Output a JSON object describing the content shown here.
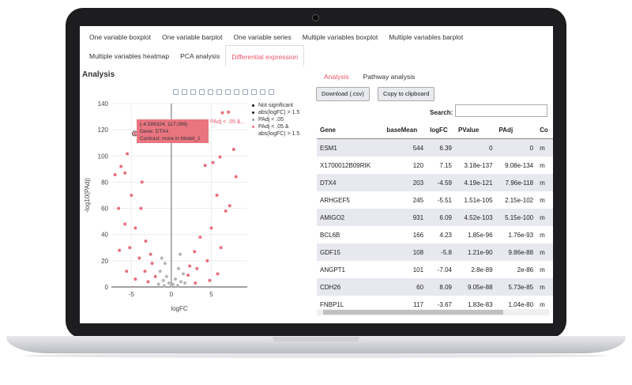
{
  "nav": {
    "row1": [
      "One variable boxplot",
      "One variable barplot",
      "One variable series",
      "Multiple variables boxplot",
      "Multiple variables barplot"
    ],
    "row2": [
      "Multiple variables heatmap",
      "PCA analysis",
      "Differential expression"
    ],
    "active": "Differential expression"
  },
  "analysis_title": "Analysis",
  "right_tabs": [
    "Analysis",
    "Pathway analysis"
  ],
  "buttons": {
    "download": "Download (.csv)",
    "clipboard": "Copy to clipboard"
  },
  "search": {
    "label": "Search:",
    "value": ""
  },
  "table": {
    "columns": [
      "Gene",
      "baseMean",
      "logFC",
      "PValue",
      "PAdj",
      "Co"
    ],
    "rows": [
      [
        "ESM1",
        "544",
        "6.39",
        "0",
        "0",
        "m"
      ],
      [
        "X1700012B09RIK",
        "120",
        "7.15",
        "3.18e-137",
        "9.08e-134",
        "m"
      ],
      [
        "DTX4",
        "203",
        "-4.59",
        "4.19e-121",
        "7.96e-118",
        "m"
      ],
      [
        "ARHGEF5",
        "245",
        "-5.51",
        "1.51e-105",
        "2.15e-102",
        "m"
      ],
      [
        "AMIGO2",
        "931",
        "6.09",
        "4.52e-103",
        "5.15e-100",
        "m"
      ],
      [
        "BCL6B",
        "166",
        "4.23",
        "1.85e-96",
        "1.76e-93",
        "m"
      ],
      [
        "GDF15",
        "108",
        "-5.8",
        "1.21e-90",
        "9.86e-88",
        "m"
      ],
      [
        "ANGPT1",
        "101",
        "-7.04",
        "2.8e-89",
        "2e-86",
        "m"
      ],
      [
        "CDH26",
        "60",
        "8.09",
        "9.05e-88",
        "5.73e-85",
        "m"
      ],
      [
        "FNBP1L",
        "117",
        "-3.67",
        "1.83e-83",
        "1.04e-80",
        "m"
      ]
    ]
  },
  "tooltip": {
    "line1": "(-4.589324, 117.099)",
    "line2": "Gene: DTX4",
    "line3": "Contrast: more in Model_1",
    "side": "PAdj < .05 &..."
  },
  "legend": [
    {
      "label": "Not significant",
      "color": "#111111"
    },
    {
      "label": "abs(logFC) > 1.5",
      "color": "#111111"
    },
    {
      "label": "PAdj < .05",
      "color": "#999999"
    },
    {
      "label": "PAdj < .05 &",
      "label2": "abs(logFC) > 1.5",
      "color": "#e8707d"
    }
  ],
  "colors": {
    "sig": "#e8707d",
    "nonsig": "#b5b5b5",
    "active": "#e8576a"
  },
  "chart_data": {
    "type": "scatter",
    "xlabel": "logFC",
    "ylabel": "-log10(PAdj)",
    "xlim": [
      -7.5,
      9.5
    ],
    "ylim": [
      0,
      140
    ],
    "xticks": [
      -5,
      0,
      5
    ],
    "yticks": [
      0,
      20,
      40,
      60,
      80,
      100,
      120,
      140
    ],
    "grid": true,
    "legend_position": "top-right",
    "highlight": [
      -4.59,
      117.1
    ],
    "series": [
      {
        "name": "PAdj < .05 & abs(logFC) > 1.5",
        "color": "#e8707d",
        "points": [
          [
            6.39,
            133
          ],
          [
            7.15,
            133.5
          ],
          [
            -4.59,
            117.1
          ],
          [
            -5.51,
            101.7
          ],
          [
            6.09,
            99.3
          ],
          [
            4.23,
            92.8
          ],
          [
            -5.8,
            87
          ],
          [
            -7.04,
            85.7
          ],
          [
            8.09,
            84.2
          ],
          [
            -3.67,
            80
          ],
          [
            -6.3,
            92
          ],
          [
            -6.6,
            60
          ],
          [
            5.2,
            95
          ],
          [
            7.8,
            105
          ],
          [
            -5.0,
            70
          ],
          [
            5.7,
            70
          ],
          [
            -3.8,
            60
          ],
          [
            6.8,
            58
          ],
          [
            5.0,
            45
          ],
          [
            -4.5,
            45
          ],
          [
            -5.8,
            48
          ],
          [
            7.3,
            62
          ],
          [
            -3.2,
            35
          ],
          [
            3.6,
            38
          ],
          [
            -5.2,
            30
          ],
          [
            6.2,
            30
          ],
          [
            -2.6,
            25
          ],
          [
            2.9,
            27
          ],
          [
            -6.5,
            28
          ],
          [
            4.5,
            20
          ],
          [
            -4.0,
            22
          ],
          [
            -2.4,
            18
          ],
          [
            2.3,
            16
          ],
          [
            -3.3,
            12
          ],
          [
            3.2,
            14
          ],
          [
            -5.6,
            12
          ],
          [
            5.8,
            10
          ],
          [
            -2.0,
            8
          ],
          [
            2.1,
            9
          ],
          [
            -4.5,
            6
          ],
          [
            4.8,
            5
          ],
          [
            -2.9,
            4
          ],
          [
            3.0,
            3
          ]
        ]
      },
      {
        "name": "Not significant",
        "color": "#b5b5b5",
        "points": [
          [
            -1.2,
            22
          ],
          [
            1.1,
            25
          ],
          [
            -0.8,
            18
          ],
          [
            0.9,
            14
          ],
          [
            -1.4,
            12
          ],
          [
            1.5,
            10
          ],
          [
            -0.6,
            8
          ],
          [
            0.5,
            6
          ],
          [
            -1.0,
            5
          ],
          [
            1.2,
            4
          ],
          [
            -0.3,
            3
          ],
          [
            0.2,
            2
          ],
          [
            -1.6,
            2
          ],
          [
            1.7,
            3
          ],
          [
            0,
            1
          ],
          [
            -0.9,
            1
          ],
          [
            0.8,
            1
          ]
        ]
      }
    ]
  }
}
